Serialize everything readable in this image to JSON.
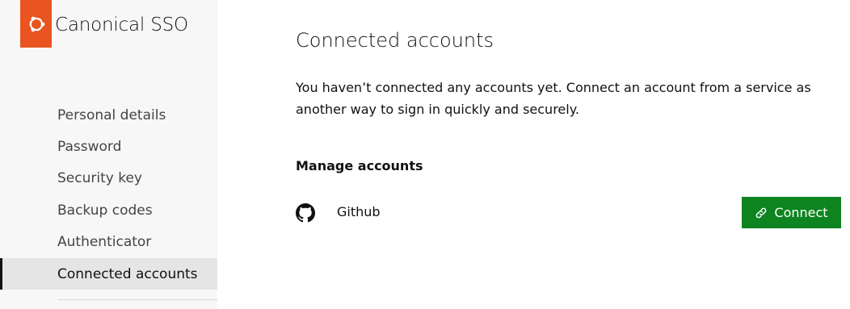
{
  "brand": {
    "name": "Canonical SSO",
    "logo_color": "#e95420"
  },
  "sidebar": {
    "items": [
      {
        "label": "Personal details",
        "active": false
      },
      {
        "label": "Password",
        "active": false
      },
      {
        "label": "Security key",
        "active": false
      },
      {
        "label": "Backup codes",
        "active": false
      },
      {
        "label": "Authenticator",
        "active": false
      },
      {
        "label": "Connected accounts",
        "active": true
      }
    ]
  },
  "main": {
    "title": "Connected accounts",
    "description": "You haven’t connected any accounts yet. Connect an account from a service as another way to sign in quickly and securely.",
    "section_title": "Manage accounts",
    "accounts": [
      {
        "name": "Github",
        "icon": "github-icon",
        "action_label": "Connect",
        "action_icon": "link-icon"
      }
    ]
  },
  "colors": {
    "accent": "#e95420",
    "positive": "#0e8420",
    "sidebar_bg": "#f7f7f7",
    "active_item_bg": "#e5e5e5"
  }
}
